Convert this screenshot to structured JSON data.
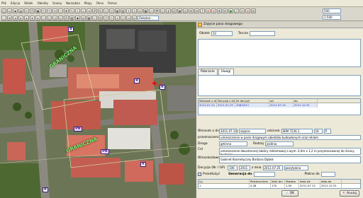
{
  "menu": [
    "Plik",
    "Edycja",
    "Widok",
    "Obiekty",
    "Szukaj",
    "Narzędzia",
    "Mapy",
    "Okno",
    "Pomoc"
  ],
  "toolbar": {
    "layer_combo": "Zwiększ...",
    "scale_value": "1:500",
    "zoom_value": "500"
  },
  "map": {
    "street_labels": [
      "GRANICZNA",
      "GRANICZNA"
    ],
    "markers": [
      "B",
      "R",
      "R",
      "PR",
      "PR",
      "R",
      "R"
    ]
  },
  "panel": {
    "title": "Zajęcie pasa drogowego",
    "obiekt_label": "Obiekt",
    "obiekt_value": "10",
    "tarcza_label": "Tarcza",
    "tabs": [
      "Pobranie",
      "Uwagi"
    ],
    "grid1": {
      "headers": [
        "Wniosek z dnia",
        "Decyzja z dn.",
        "Nr decyzji",
        "od",
        "do"
      ],
      "rows": [
        [
          "2011.07.14",
          "2011.07.25",
          "106/2011",
          "2011.07.15",
          "2011.12.31"
        ]
      ]
    },
    "wniosek_label": "Wniosek z dnia",
    "wniosek_value": "2011.07.14",
    "zajecie_value": "zajęcie",
    "odcinek_label": "odcinek",
    "odcinek_value": "SKM 7236.1",
    "odcinek_num": "16",
    "odcinek_suffix": "P",
    "przeznaczenie_label": "przeznaczenie",
    "przeznaczenie_value": "umieszczenie w pasie drogowym obiektów budowlanych oraz reklam",
    "droga_label": "Droga",
    "droga_value": "gminna",
    "rodzaj_label": "Rodzaj",
    "rodzaj_value": "jezdnia",
    "cel_label": "Cel",
    "cel_value": "umieszczenie dwustronnej tablicy reklamowej o wym. 0,4m x 1,2 m przymocowanej do ściany budynku",
    "wnioskodawca_label": "Wnioskodawca",
    "wnioskodawca_value": "Gabinet Kosmetyczny Barbara Dąbek",
    "decyzja_label": "Decyzja (Nr / GP)",
    "decyzja_nr": "106",
    "decyzja_rok": "2011",
    "z_dnia_label": "z dnia",
    "z_dnia_value": "2011.07.25",
    "typ_value": "pozytywna",
    "platne_label": "Płatne do",
    "przedluzyc_label": "Przedłużyć",
    "generacja_label": "Generacja do",
    "grid2": {
      "headers": [
        "Lp.",
        "Powierzchnia",
        "Ilość dni",
        "Stawka",
        "data od",
        "data do"
      ],
      "rows": [
        [
          "1",
          "0,48",
          "170",
          "1,00",
          "2011.07.15",
          "2011.12.31"
        ]
      ]
    },
    "ok_label": "OK",
    "cancel_label": "Anuluj"
  },
  "colors": {
    "street_label": "#7cf26a",
    "marker_border": "#3a1d7a",
    "ok_check": "#1f9b1f",
    "cancel_x": "#d01010"
  }
}
